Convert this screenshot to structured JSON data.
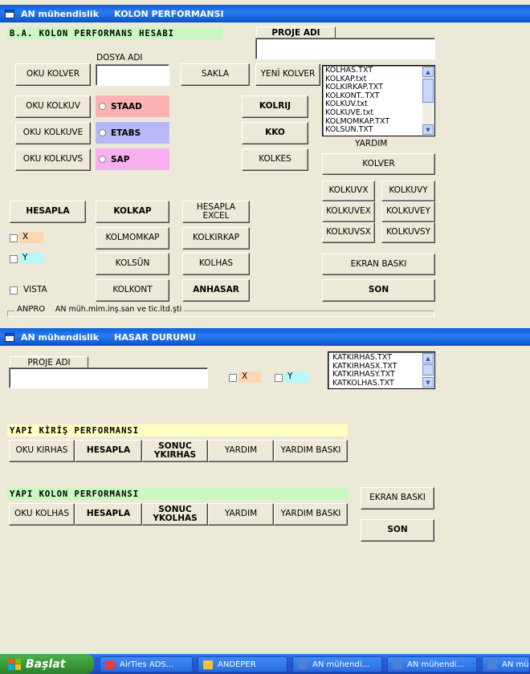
{
  "window1": {
    "title": "AN mühendislik     KOLON PERFORMANSI",
    "header": "B.A. KOLON PERFORMANS HESABI",
    "proje_adi_label": "PROJE ADI",
    "proje_adi_value": "",
    "dosya_adi_label": "DOSYA ADI",
    "dosya_adi_value": "",
    "buttons": {
      "oku_kolver": "OKU KOLVER",
      "sakla": "SAKLA",
      "yeni_kolver": "YENİ KOLVER",
      "oku_kolkuv": "OKU KOLKUV",
      "oku_kolkuve": "OKU KOLKUVE",
      "oku_kolkuvs": "OKU KOLKUVS",
      "kolrij": "KOLRIJ",
      "kko": "KKO",
      "kolkes": "KOLKES",
      "kolver": "KOLVER",
      "kolkuvx": "KOLKUVX",
      "kolkuvy": "KOLKUVY",
      "kolkuvex": "KOLKUVEX",
      "kolkuvey": "KOLKUVEY",
      "kolkuvsx": "KOLKUVSX",
      "kolkuvsy": "KOLKUVSY",
      "hesapla": "HESAPLA",
      "kolkap": "KOLKAP",
      "hesapla_excel": "HESAPLA EXCEL",
      "kolmomkap": "KOLMOMKAP",
      "kolkirkap": "KOLKIRKAP",
      "kolsun": "KOLSÜN",
      "kolhas": "KOLHAS",
      "kolkont": "KOLKONT",
      "anhasar": "ANHASAR",
      "ekran_baski": "EKRAN BASKI",
      "son": "SON"
    },
    "radios": {
      "staad": "STAAD",
      "etabs": "ETABS",
      "sap": "SAP"
    },
    "checks": {
      "x": "X",
      "y": "Y",
      "vista": "VISTA"
    },
    "file_list": [
      "KOLHAS.TXT",
      "KOLKAP.txt",
      "KOLKIRKAP.TXT",
      "KOLKONT..TXT",
      "KOLKUV.txt",
      "KOLKUVE.txt",
      "KOLMOMKAP.TXT",
      "KOLSUN.TXT"
    ],
    "yardim_label": "YARDIM",
    "footer_anpro": "ANPRO",
    "footer_company": "AN müh.mim.inş.san ve tic.ltd.şti",
    "colors": {
      "staad_bg": "#fbb3b3",
      "etabs_bg": "#b8b8f8",
      "sap_bg": "#f8b0f0",
      "header_bg": "#c8f8c0",
      "x_bg": "#fad7b0",
      "y_bg": "#b8f8f8"
    }
  },
  "window2": {
    "title": "AN mühendislik     HASAR DURUMU",
    "proje_adi_label": "PROJE ADI",
    "proje_adi_value": "",
    "checks": {
      "x": "X",
      "y": "Y"
    },
    "file_list": [
      "KATKIRHAS.TXT",
      "KATKIRHASX.TXT",
      "KATKIRHASY.TXT",
      "KATKOLHAS.TXT"
    ],
    "kiris_header": "YAPI KİRİŞ  PERFORMANSI",
    "kolon_header": "YAPI KOLON PERFORMANSI",
    "kiris_buttons": [
      "OKU KIRHAS",
      "HESAPLA",
      "SONUC YKIRHAS",
      "YARDIM",
      "YARDIM BASKI"
    ],
    "kolon_buttons": [
      "OKU  KOLHAS",
      "HESAPLA",
      "SONUC YKOLHAS",
      "YARDIM",
      "YARDIM BASKI"
    ],
    "ekran_baski": "EKRAN BASKI",
    "son": "SON",
    "colors": {
      "kiris_bg": "#ffffc0",
      "kolon_bg": "#c8f8c0"
    }
  },
  "taskbar": {
    "start_label": "Başlat",
    "tasks": [
      "AirTies ADS...",
      "ANDEPER",
      "AN mühendi...",
      "AN mühendi...",
      "AN mü"
    ]
  }
}
